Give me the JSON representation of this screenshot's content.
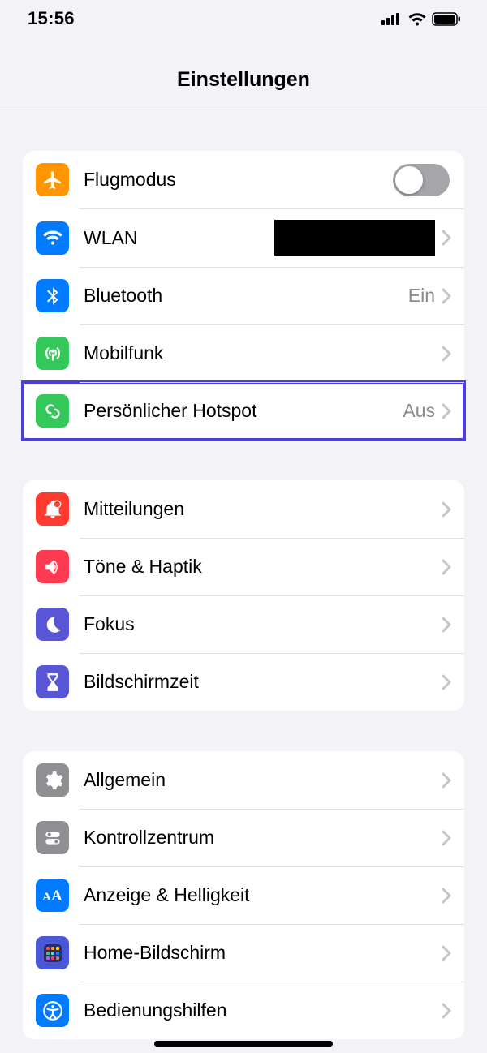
{
  "status": {
    "time": "15:56"
  },
  "header": {
    "title": "Einstellungen"
  },
  "groups": [
    {
      "rows": [
        {
          "label": "Flugmodus"
        },
        {
          "label": "WLAN"
        },
        {
          "label": "Bluetooth",
          "value": "Ein"
        },
        {
          "label": "Mobilfunk"
        },
        {
          "label": "Persönlicher Hotspot",
          "value": "Aus"
        }
      ]
    },
    {
      "rows": [
        {
          "label": "Mitteilungen"
        },
        {
          "label": "Töne & Haptik"
        },
        {
          "label": "Fokus"
        },
        {
          "label": "Bildschirmzeit"
        }
      ]
    },
    {
      "rows": [
        {
          "label": "Allgemein"
        },
        {
          "label": "Kontrollzentrum"
        },
        {
          "label": "Anzeige & Helligkeit"
        },
        {
          "label": "Home-Bildschirm"
        },
        {
          "label": "Bedienungshilfen"
        }
      ]
    }
  ],
  "colors": {
    "orange": "#ff9500",
    "blue": "#007aff",
    "green": "#34c759",
    "red": "#ff3b30",
    "indigo": "#5856d6",
    "gray": "#8e8e93"
  }
}
